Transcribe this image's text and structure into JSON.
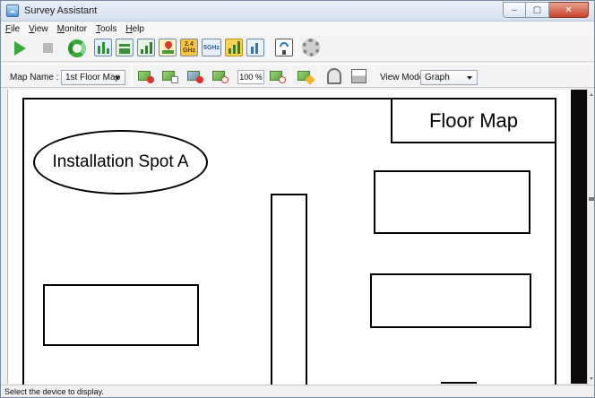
{
  "window": {
    "title": "Survey Assistant",
    "controls": {
      "minimize": "–",
      "maximize": "▢",
      "close": "✕"
    }
  },
  "menu": [
    {
      "label": "File",
      "mnemonic": "F"
    },
    {
      "label": "View",
      "mnemonic": "V"
    },
    {
      "label": "Monitor",
      "mnemonic": "M"
    },
    {
      "label": "Tools",
      "mnemonic": "T"
    },
    {
      "label": "Help",
      "mnemonic": "H"
    }
  ],
  "toolbar_main": {
    "icons": [
      "play-icon",
      "stop-icon",
      "refresh-icon",
      "chart-grid-icon",
      "chart-list-icon",
      "chart-bar-icon",
      "map-pin-chart-icon",
      "band-2-4-icon",
      "band-5-icon",
      "signal-bars-icon",
      "export-chart-icon",
      "wireless-device-icon",
      "gear-icon"
    ],
    "band_2_4_label": "2.4\nGHz",
    "band_5_label": "5GHz"
  },
  "toolbar_map": {
    "map_name_label": "Map Name :",
    "map_name_value": "1st Floor Map",
    "zoom_value": "100 %",
    "view_mode_label": "View Mode :",
    "view_mode_value": "Graph",
    "icons": [
      "add-map-icon",
      "edit-map-icon",
      "delete-map-icon",
      "zoom-out-icon",
      "zoom-in-icon",
      "pencil-map-icon",
      "locate-icon",
      "print-icon"
    ]
  },
  "map": {
    "title": "Floor Map",
    "installation_spot": "Installation Spot A"
  },
  "status": {
    "text": "Select the device to display."
  },
  "colors": {
    "accent_green": "#3aa83a",
    "close_red": "#c8432b",
    "map_background": "#ffffff",
    "side_panel": "#0b0b0b"
  }
}
